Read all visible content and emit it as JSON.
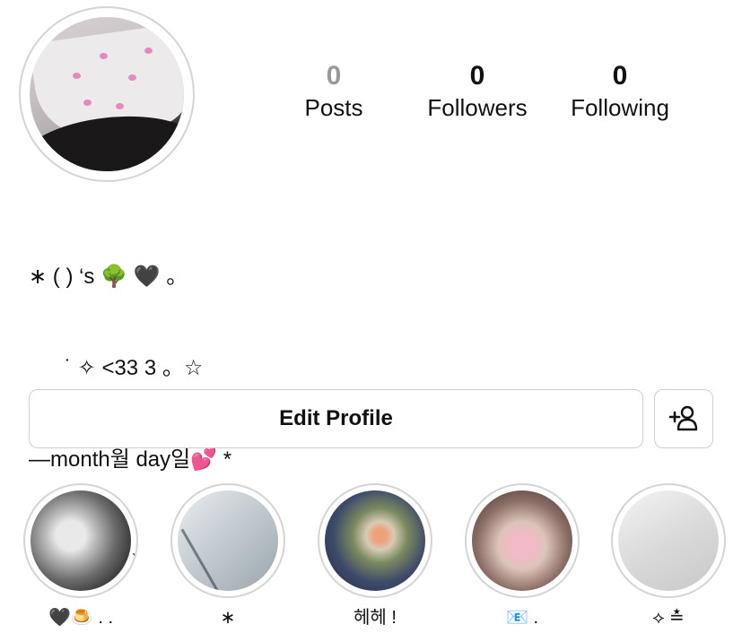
{
  "profile": {
    "stats": [
      {
        "value": "0",
        "label": "Posts"
      },
      {
        "value": "0",
        "label": "Followers"
      },
      {
        "value": "0",
        "label": "Following"
      }
    ],
    "bio_lines": [
      "∗ ( ) ‘s 🌳 🖤 。",
      "      ˙ ✧ <33 3 。☆",
      "—month월 day일💕 *",
      "  。° 。 °。 ° °。 ° 、"
    ]
  },
  "actions": {
    "edit_profile": "Edit Profile",
    "add_person_icon": "add-person-icon"
  },
  "highlights": [
    {
      "label": "🖤🍮 . ."
    },
    {
      "label": "∗"
    },
    {
      "label": "헤헤 !"
    },
    {
      "label": "📧 ."
    },
    {
      "label": "⟡ ≛"
    }
  ]
}
